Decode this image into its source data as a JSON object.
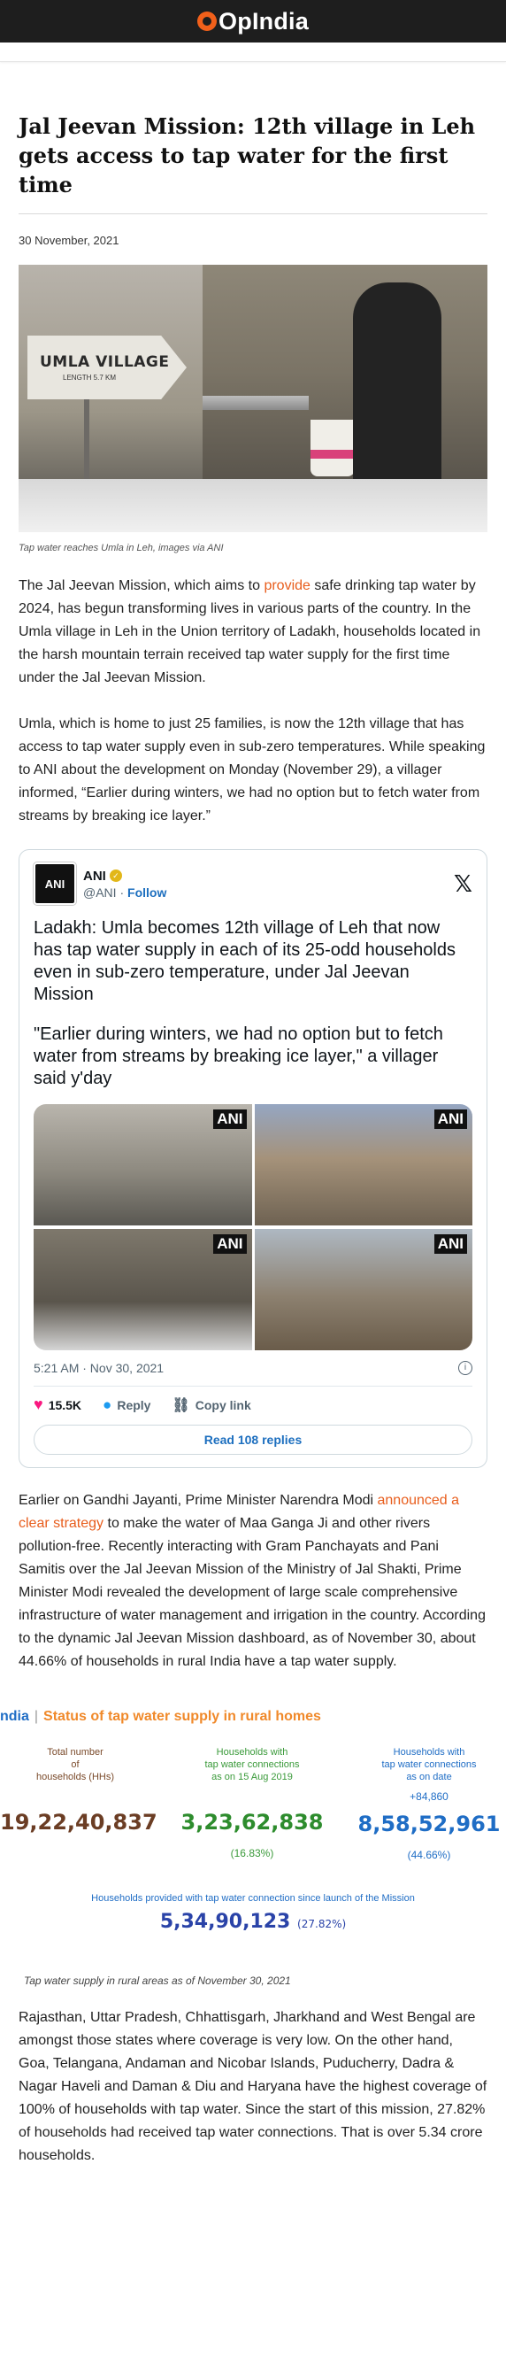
{
  "site": {
    "logo": "OpIndia",
    "logo_accent": "#f2601a"
  },
  "article": {
    "title": "Jal Jeevan Mission: 12th village in Leh gets access to tap water for the first time",
    "date": "30 November, 2021",
    "hero_caption": "Tap water reaches Umla in Leh, images via ANI",
    "hero_sign": {
      "main": "UMLA VILLAGE",
      "sub": "LENGTH  5.7 KM"
    },
    "para1": {
      "before": "The Jal Jeevan Mission, which aims to ",
      "link": "provide",
      "after": " safe drinking tap water by 2024, has begun transforming lives in various parts of the country. In the Umla village in Leh in the Union territory of Ladakh, households located in the harsh mountain terrain received tap water supply for the first time under the Jal Jeevan Mission."
    },
    "para2": "Umla, which is home to just 25 families, is now the 12th village that has access to tap water supply even in sub-zero temperatures. While speaking to ANI about the development on Monday (November 29), a villager informed, “Earlier during winters, we had no option but to fetch water from streams by breaking ice layer.”",
    "para3": {
      "before": "Earlier on Gandhi Jayanti, Prime Minister Narendra Modi ",
      "link": "announced a clear strategy",
      "after": " to make the water of Maa Ganga Ji and other rivers pollution-free. Recently interacting with Gram Panchayats and Pani Samitis over the Jal Jeevan Mission of the Ministry of Jal Shakti, Prime Minister Modi revealed the development of large scale comprehensive infrastructure of water management and irrigation in the country. According to the dynamic Jal Jeevan Mission dashboard, as of November 30, about 44.66% of households in rural India have a tap water supply."
    },
    "infographic_caption": "Tap water supply in rural areas as of November 30, 2021",
    "para4": "Rajasthan, Uttar Pradesh, Chhattisgarh, Jharkhand and West Bengal are amongst those states where coverage is very low. On the other hand, Goa, Telangana, Andaman and Nicobar Islands, Puducherry, Dadra & Nagar Haveli and Daman & Diu and Haryana have the highest coverage of 100% of households with tap water. Since the start of this mission, 27.82% of households had received tap water connections. That is over 5.34 crore households."
  },
  "tweet": {
    "name": "ANI",
    "avatar_text": "ANI",
    "handle": "@ANI",
    "separator": "·",
    "follow_label": "Follow",
    "x_icon": "𝕏",
    "text": "Ladakh: Umla becomes 12th village of Leh that now has tap water supply in each of its 25-odd households even in sub-zero temperature, under Jal Jeevan Mission",
    "quote": "\"Earlier during winters, we had no option but to fetch water from streams by breaking ice layer,\" a villager said y'day",
    "image_badge": "ANI",
    "timestamp": "5:21 AM · Nov 30, 2021",
    "likes": "15.5K",
    "reply_label": "Reply",
    "copy_link_label": "Copy link",
    "read_replies_label": "Read 108 replies"
  },
  "infographic": {
    "brand": "ndia",
    "separator": "|",
    "title": "Status of tap water supply in rural homes",
    "total": {
      "label_line1": "Total number",
      "label_line2": "of",
      "label_line3": "households (HHs)",
      "value": "19,22,40,837"
    },
    "aug2019": {
      "label_line1": "Households with",
      "label_line2": "tap water connections",
      "label_line3": "as on 15 Aug 2019",
      "value": "3,23,62,838",
      "pct": "(16.83%)"
    },
    "ondate": {
      "label_line1": "Households with",
      "label_line2": "tap water connections",
      "label_line3": "as on date",
      "extra": "+84,860",
      "value": "8,58,52,961",
      "pct": "(44.66%)"
    },
    "since_launch": {
      "label": "Households provided with tap water connection since launch of the Mission",
      "value": "5,34,90,123",
      "pct": "(27.82%)"
    }
  }
}
